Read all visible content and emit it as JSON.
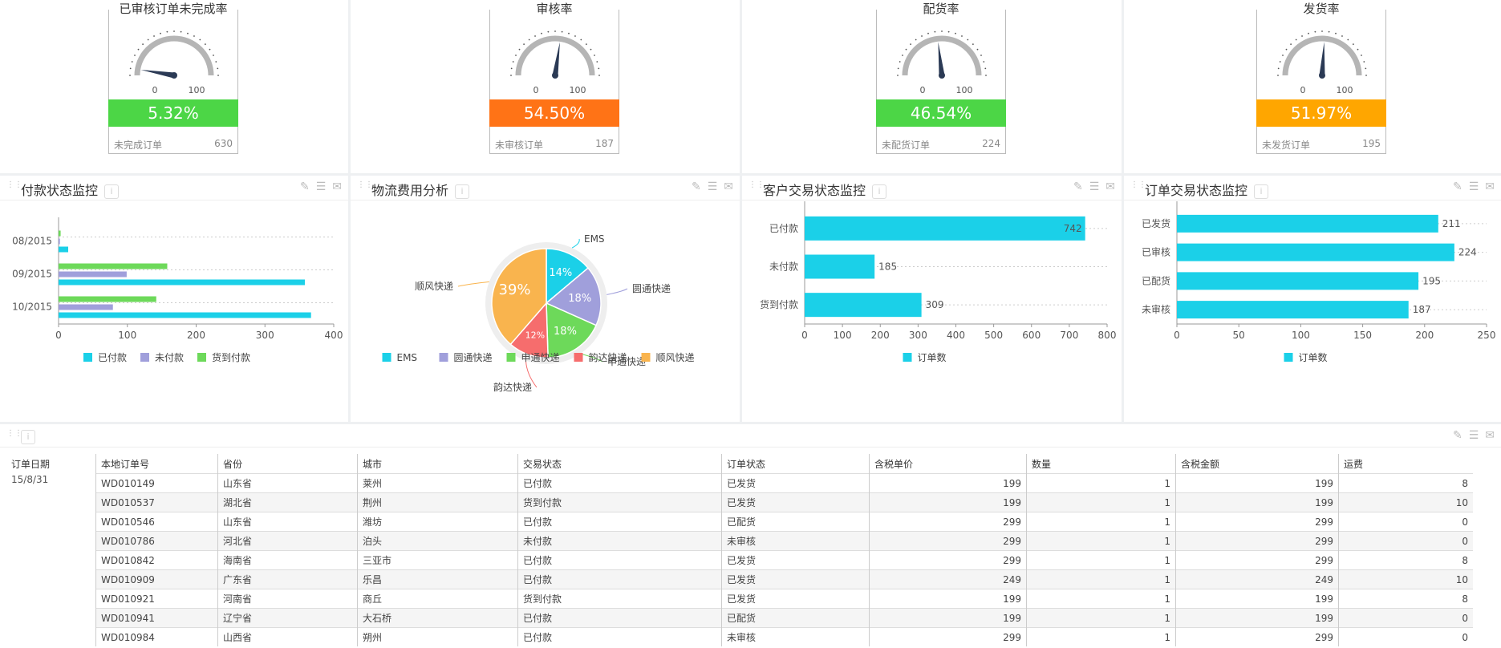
{
  "gauges": [
    {
      "title": "已审核订单未完成率",
      "value_text": "5.32%",
      "value": 5.32,
      "min": "0",
      "max": "100",
      "foot_label": "未完成订单",
      "foot_value": "630",
      "color": "#4cd646"
    },
    {
      "title": "审核率",
      "value_text": "54.50%",
      "value": 54.5,
      "min": "0",
      "max": "100",
      "foot_label": "未审核订单",
      "foot_value": "187",
      "color": "#ff7316"
    },
    {
      "title": "配货率",
      "value_text": "46.54%",
      "value": 46.54,
      "min": "0",
      "max": "100",
      "foot_label": "未配货订单",
      "foot_value": "224",
      "color": "#4cd646"
    },
    {
      "title": "发货率",
      "value_text": "51.97%",
      "value": 51.97,
      "min": "0",
      "max": "100",
      "foot_label": "未发货订单",
      "foot_value": "195",
      "color": "#ffa600"
    }
  ],
  "panels": {
    "payment": {
      "title": "付款状态监控"
    },
    "logistics": {
      "title": "物流费用分析"
    },
    "customer": {
      "title": "客户交易状态监控"
    },
    "order": {
      "title": "订单交易状态监控"
    }
  },
  "colors": {
    "cyan": "#1bd0e8",
    "purple": "#a09fdb",
    "green": "#6dd95a",
    "red": "#f66d6d",
    "orange": "#f9b44e"
  },
  "chart_data": [
    {
      "type": "bar",
      "orientation": "horizontal",
      "categories": [
        "08/2015",
        "09/2015",
        "10/2015"
      ],
      "series": [
        {
          "name": "已付款",
          "values": [
            14,
            358,
            367
          ]
        },
        {
          "name": "未付款",
          "values": [
            2,
            99,
            79
          ]
        },
        {
          "name": "货到付款",
          "values": [
            3,
            158,
            142
          ]
        }
      ],
      "xlim": [
        0,
        400
      ],
      "xticks": [
        "0",
        "100",
        "200",
        "300",
        "400"
      ],
      "legend": "bottom",
      "grid": true
    },
    {
      "type": "pie",
      "slices": [
        {
          "name": "EMS",
          "value": 14,
          "label": "14%"
        },
        {
          "name": "圆通快递",
          "value": 18,
          "label": "18%"
        },
        {
          "name": "申通快递",
          "value": 18,
          "label": "18%"
        },
        {
          "name": "韵达快递",
          "value": 12,
          "label": "12%"
        },
        {
          "name": "顺风快递",
          "value": 39,
          "label": "39%"
        }
      ],
      "legend": "bottom"
    },
    {
      "type": "bar",
      "orientation": "horizontal",
      "categories": [
        "已付款",
        "未付款",
        "货到付款"
      ],
      "series": [
        {
          "name": "订单数",
          "values": [
            742,
            185,
            309
          ]
        }
      ],
      "value_labels": [
        "742",
        "185",
        "309"
      ],
      "xlim": [
        0,
        800
      ],
      "xticks": [
        "0",
        "100",
        "200",
        "300",
        "400",
        "500",
        "600",
        "700",
        "800"
      ],
      "legend": "bottom"
    },
    {
      "type": "bar",
      "orientation": "horizontal",
      "categories": [
        "已发货",
        "已审核",
        "已配货",
        "未审核"
      ],
      "series": [
        {
          "name": "订单数",
          "values": [
            211,
            224,
            195,
            187
          ]
        }
      ],
      "value_labels": [
        "211",
        "224",
        "195",
        "187"
      ],
      "xlim": [
        0,
        250
      ],
      "xticks": [
        "0",
        "50",
        "100",
        "150",
        "200",
        "250"
      ],
      "legend": "bottom"
    }
  ],
  "table": {
    "columns": [
      "订单日期",
      "本地订单号",
      "省份",
      "城市",
      "交易状态",
      "订单状态",
      "含税单价",
      "数量",
      "含税金额",
      "运费"
    ],
    "date": "15/8/31",
    "rows": [
      [
        "WD010149",
        "山东省",
        "莱州",
        "已付款",
        "已发货",
        "199",
        "1",
        "199",
        "8"
      ],
      [
        "WD010537",
        "湖北省",
        "荆州",
        "货到付款",
        "已发货",
        "199",
        "1",
        "199",
        "10"
      ],
      [
        "WD010546",
        "山东省",
        "潍坊",
        "已付款",
        "已配货",
        "299",
        "1",
        "299",
        "0"
      ],
      [
        "WD010786",
        "河北省",
        "泊头",
        "未付款",
        "未审核",
        "299",
        "1",
        "299",
        "0"
      ],
      [
        "WD010842",
        "海南省",
        "三亚市",
        "已付款",
        "已发货",
        "299",
        "1",
        "299",
        "8"
      ],
      [
        "WD010909",
        "广东省",
        "乐昌",
        "已付款",
        "已发货",
        "249",
        "1",
        "249",
        "10"
      ],
      [
        "WD010921",
        "河南省",
        "商丘",
        "货到付款",
        "已发货",
        "199",
        "1",
        "199",
        "8"
      ],
      [
        "WD010941",
        "辽宁省",
        "大石桥",
        "已付款",
        "已配货",
        "199",
        "1",
        "199",
        "0"
      ],
      [
        "WD010984",
        "山西省",
        "朔州",
        "已付款",
        "未审核",
        "299",
        "1",
        "299",
        "0"
      ]
    ]
  },
  "icons": {
    "drag": "drag-handle-icon",
    "info": "info-icon",
    "edit": "pencil-icon",
    "menu": "menu-icon",
    "mail": "mail-icon"
  }
}
